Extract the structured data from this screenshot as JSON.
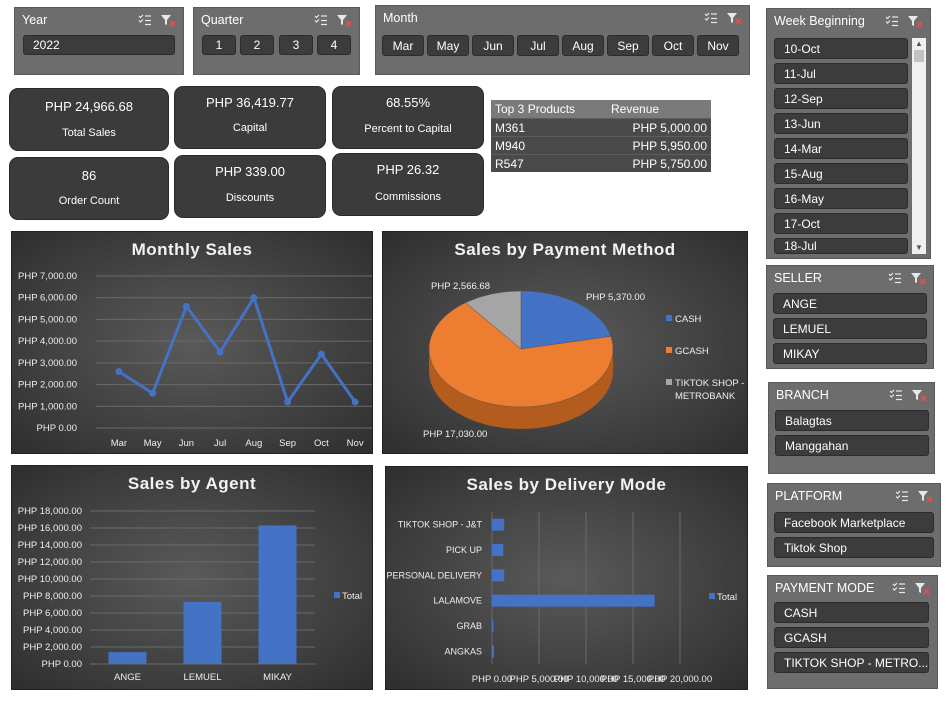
{
  "slicers": {
    "year": {
      "title": "Year",
      "items": [
        "2022"
      ]
    },
    "quarter": {
      "title": "Quarter",
      "items": [
        "1",
        "2",
        "3",
        "4"
      ]
    },
    "month": {
      "title": "Month",
      "items": [
        "Mar",
        "May",
        "Jun",
        "Jul",
        "Aug",
        "Sep",
        "Oct",
        "Nov"
      ]
    },
    "week": {
      "title": "Week Beginning",
      "items": [
        "10-Oct",
        "11-Jul",
        "12-Sep",
        "13-Jun",
        "14-Mar",
        "15-Aug",
        "16-May",
        "17-Oct",
        "18-Jul"
      ]
    },
    "seller": {
      "title": "SELLER",
      "items": [
        "ANGE",
        "LEMUEL",
        "MIKAY"
      ]
    },
    "branch": {
      "title": "BRANCH",
      "items": [
        "Balagtas",
        "Manggahan"
      ]
    },
    "platform": {
      "title": "PLATFORM",
      "items": [
        "Facebook Marketplace",
        "Tiktok Shop"
      ]
    },
    "payment": {
      "title": "PAYMENT MODE",
      "items": [
        "CASH",
        "GCASH",
        "TIKTOK SHOP - METRO..."
      ]
    }
  },
  "kpis": [
    {
      "value": "PHP 24,966.68",
      "label": "Total Sales"
    },
    {
      "value": "PHP 36,419.77",
      "label": "Capital"
    },
    {
      "value": "68.55%",
      "label": "Percent to Capital"
    },
    {
      "value": "86",
      "label": "Order Count"
    },
    {
      "value": "PHP 339.00",
      "label": "Discounts"
    },
    {
      "value": "PHP 26.32",
      "label": "Commissions"
    }
  ],
  "top_products": {
    "headers": [
      "Top 3 Products",
      "Revenue"
    ],
    "rows": [
      [
        "M361",
        "PHP 5,000.00"
      ],
      [
        "M940",
        "PHP 5,950.00"
      ],
      [
        "R547",
        "PHP 5,750.00"
      ]
    ]
  },
  "colors": {
    "blue": "#4472c4",
    "orange": "#ed7d31",
    "gray": "#a5a5a5",
    "panel": "#6d6d6d"
  },
  "icons": [
    "multi-select-icon",
    "clear-filter-icon"
  ],
  "chart_data": [
    {
      "type": "line",
      "title": "Monthly Sales",
      "categories": [
        "Mar",
        "May",
        "Jun",
        "Jul",
        "Aug",
        "Sep",
        "Oct",
        "Nov"
      ],
      "values": [
        2600,
        1600,
        5600,
        3500,
        6000,
        1200,
        3400,
        1200
      ],
      "ylim": [
        0,
        7000
      ],
      "yticks": [
        "PHP 0.00",
        "PHP 1,000.00",
        "PHP 2,000.00",
        "PHP 3,000.00",
        "PHP 4,000.00",
        "PHP 5,000.00",
        "PHP 6,000.00",
        "PHP 7,000.00"
      ],
      "grid": true
    },
    {
      "type": "pie",
      "title": "Sales by Payment Method",
      "labels": [
        "CASH",
        "GCASH",
        "TIKTOK SHOP - METROBANK"
      ],
      "values": [
        5370,
        17030,
        2566.68
      ],
      "data_labels": [
        "PHP 5,370.00",
        "PHP 17,030.00",
        "PHP 2,566.68"
      ],
      "legend": "right"
    },
    {
      "type": "bar",
      "title": "Sales by Agent",
      "categories": [
        "ANGE",
        "LEMUEL",
        "MIKAY"
      ],
      "series": [
        {
          "name": "Total",
          "values": [
            1400,
            7300,
            16300
          ]
        }
      ],
      "ylim": [
        0,
        18000
      ],
      "yticks": [
        "PHP 0.00",
        "PHP 2,000.00",
        "PHP 4,000.00",
        "PHP 6,000.00",
        "PHP 8,000.00",
        "PHP 10,000.00",
        "PHP 12,000.00",
        "PHP 14,000.00",
        "PHP 16,000.00",
        "PHP 18,000.00"
      ],
      "legend": "right"
    },
    {
      "type": "bar",
      "orientation": "horizontal",
      "title": "Sales by Delivery Mode",
      "categories": [
        "TIKTOK SHOP - J&T",
        "PICK UP",
        "PERSONAL DELIVERY",
        "LALAMOVE",
        "GRAB",
        "ANGKAS"
      ],
      "series": [
        {
          "name": "Total",
          "values": [
            1300,
            1200,
            1300,
            17300,
            150,
            200
          ]
        }
      ],
      "xlim": [
        0,
        20000
      ],
      "xticks": [
        "PHP 0.00",
        "PHP 5,000.00",
        "PHP 10,000.00",
        "PHP 15,000.00",
        "PHP 20,000.00"
      ],
      "legend": "right"
    }
  ]
}
